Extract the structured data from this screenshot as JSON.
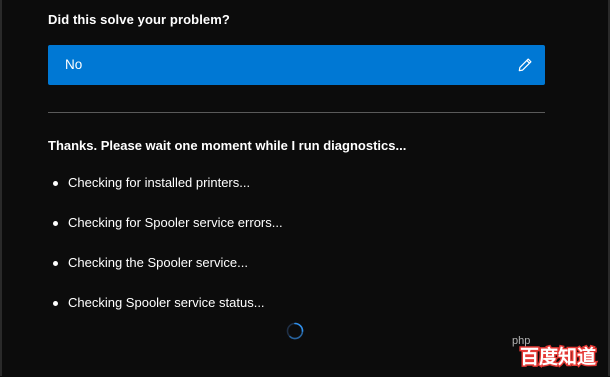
{
  "feedback": {
    "question": "Did this solve your problem?",
    "answer": "No",
    "icons": {
      "edit": "pencil-edit-icon"
    }
  },
  "diagnostics": {
    "heading": "Thanks. Please wait one moment while I run diagnostics...",
    "items": [
      "Checking for installed printers...",
      "Checking for Spooler service errors...",
      "Checking the Spooler service...",
      "Checking Spooler service status..."
    ],
    "loading_icon": "spinner-icon"
  },
  "watermark": {
    "text": "百度知道",
    "prefix": "php",
    "icon": "baidu-zhidao-logo"
  },
  "colors": {
    "background": "#0c0c0c",
    "accent": "#0078d4",
    "divider": "#5a5a5a",
    "watermark": "#e53935"
  }
}
